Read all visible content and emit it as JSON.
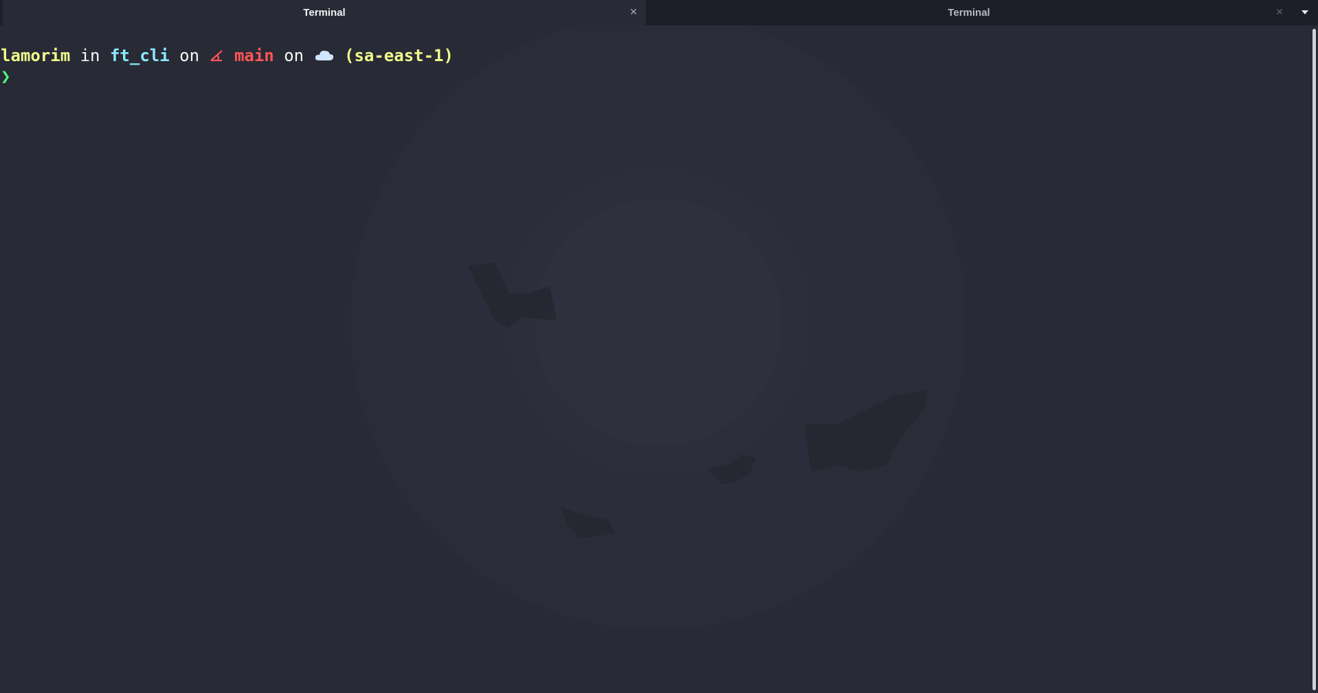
{
  "tabs": [
    {
      "label": "Terminal",
      "active": true
    },
    {
      "label": "Terminal",
      "active": false
    }
  ],
  "terminal": {
    "prompt_line": {
      "user": "lamorim",
      "in_word": "in",
      "directory": "ft_cli",
      "on_word_1": "on",
      "branch_icon": "git-branch-icon",
      "branch": "main",
      "on_word_2": "on",
      "cloud_icon": "cloud-icon",
      "aws_region": "(sa-east-1)"
    },
    "input_prompt": "❯"
  },
  "colors": {
    "background": "#282a36",
    "tabbar": "#1d1e27",
    "user": "#f1fa8c",
    "directory": "#8be9fd",
    "branch": "#ff5555",
    "region": "#f1fa8c",
    "prompt": "#50fa7b"
  }
}
